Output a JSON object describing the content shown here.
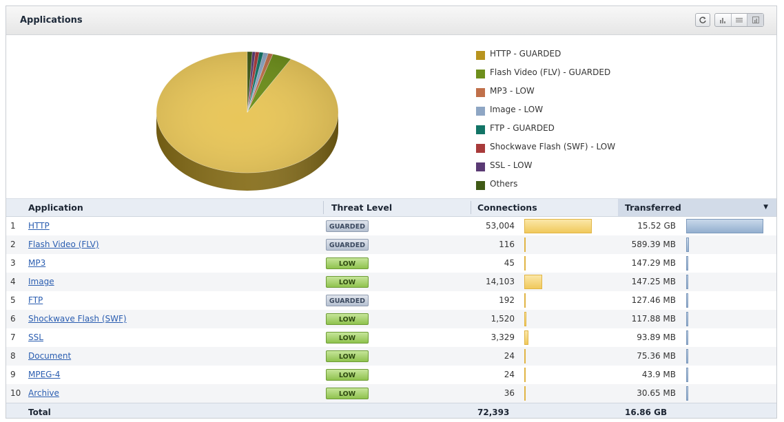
{
  "panel": {
    "title": "Applications",
    "toolbar": [
      "refresh-icon",
      "bar-chart-icon",
      "list-view-icon",
      "pie-chart-icon"
    ]
  },
  "chart_data": {
    "type": "pie",
    "legend": [
      "HTTP - GUARDED",
      "Flash Video (FLV) - GUARDED",
      "MP3 - LOW",
      "Image - LOW",
      "FTP - GUARDED",
      "Shockwave Flash (SWF) - LOW",
      "SSL - LOW",
      "Others"
    ],
    "values_mb": [
      15892,
      589.39,
      147.29,
      147.25,
      127.46,
      117.88,
      93.89,
      149.94
    ],
    "colors": [
      "#b8941f",
      "#6e8f1c",
      "#c0704a",
      "#8ea6c4",
      "#127466",
      "#a83a3a",
      "#5a3a74",
      "#3f5a16"
    ],
    "legend_position": "right"
  },
  "table": {
    "headers": {
      "application": "Application",
      "threat": "Threat Level",
      "connections": "Connections",
      "transferred": "Transferred",
      "sort_arrow": "▼"
    },
    "rows": [
      {
        "idx": "1",
        "name": "HTTP",
        "threat": "GUARDED",
        "conn": "53,004",
        "conn_n": 53004,
        "xfer": "15.52 GB",
        "xfer_mb": 15892
      },
      {
        "idx": "2",
        "name": "Flash Video (FLV)",
        "threat": "GUARDED",
        "conn": "116",
        "conn_n": 116,
        "xfer": "589.39 MB",
        "xfer_mb": 589.39
      },
      {
        "idx": "3",
        "name": "MP3",
        "threat": "LOW",
        "conn": "45",
        "conn_n": 45,
        "xfer": "147.29 MB",
        "xfer_mb": 147.29
      },
      {
        "idx": "4",
        "name": "Image",
        "threat": "LOW",
        "conn": "14,103",
        "conn_n": 14103,
        "xfer": "147.25 MB",
        "xfer_mb": 147.25
      },
      {
        "idx": "5",
        "name": "FTP",
        "threat": "GUARDED",
        "conn": "192",
        "conn_n": 192,
        "xfer": "127.46 MB",
        "xfer_mb": 127.46
      },
      {
        "idx": "6",
        "name": "Shockwave Flash (SWF)",
        "threat": "LOW",
        "conn": "1,520",
        "conn_n": 1520,
        "xfer": "117.88 MB",
        "xfer_mb": 117.88
      },
      {
        "idx": "7",
        "name": "SSL",
        "threat": "LOW",
        "conn": "3,329",
        "conn_n": 3329,
        "xfer": "93.89 MB",
        "xfer_mb": 93.89
      },
      {
        "idx": "8",
        "name": "Document",
        "threat": "LOW",
        "conn": "24",
        "conn_n": 24,
        "xfer": "75.36 MB",
        "xfer_mb": 75.36
      },
      {
        "idx": "9",
        "name": "MPEG-4",
        "threat": "LOW",
        "conn": "24",
        "conn_n": 24,
        "xfer": "43.9 MB",
        "xfer_mb": 43.9
      },
      {
        "idx": "10",
        "name": "Archive",
        "threat": "LOW",
        "conn": "36",
        "conn_n": 36,
        "xfer": "30.65 MB",
        "xfer_mb": 30.65
      }
    ],
    "total": {
      "label": "Total",
      "conn": "72,393",
      "xfer": "16.86 GB"
    }
  }
}
